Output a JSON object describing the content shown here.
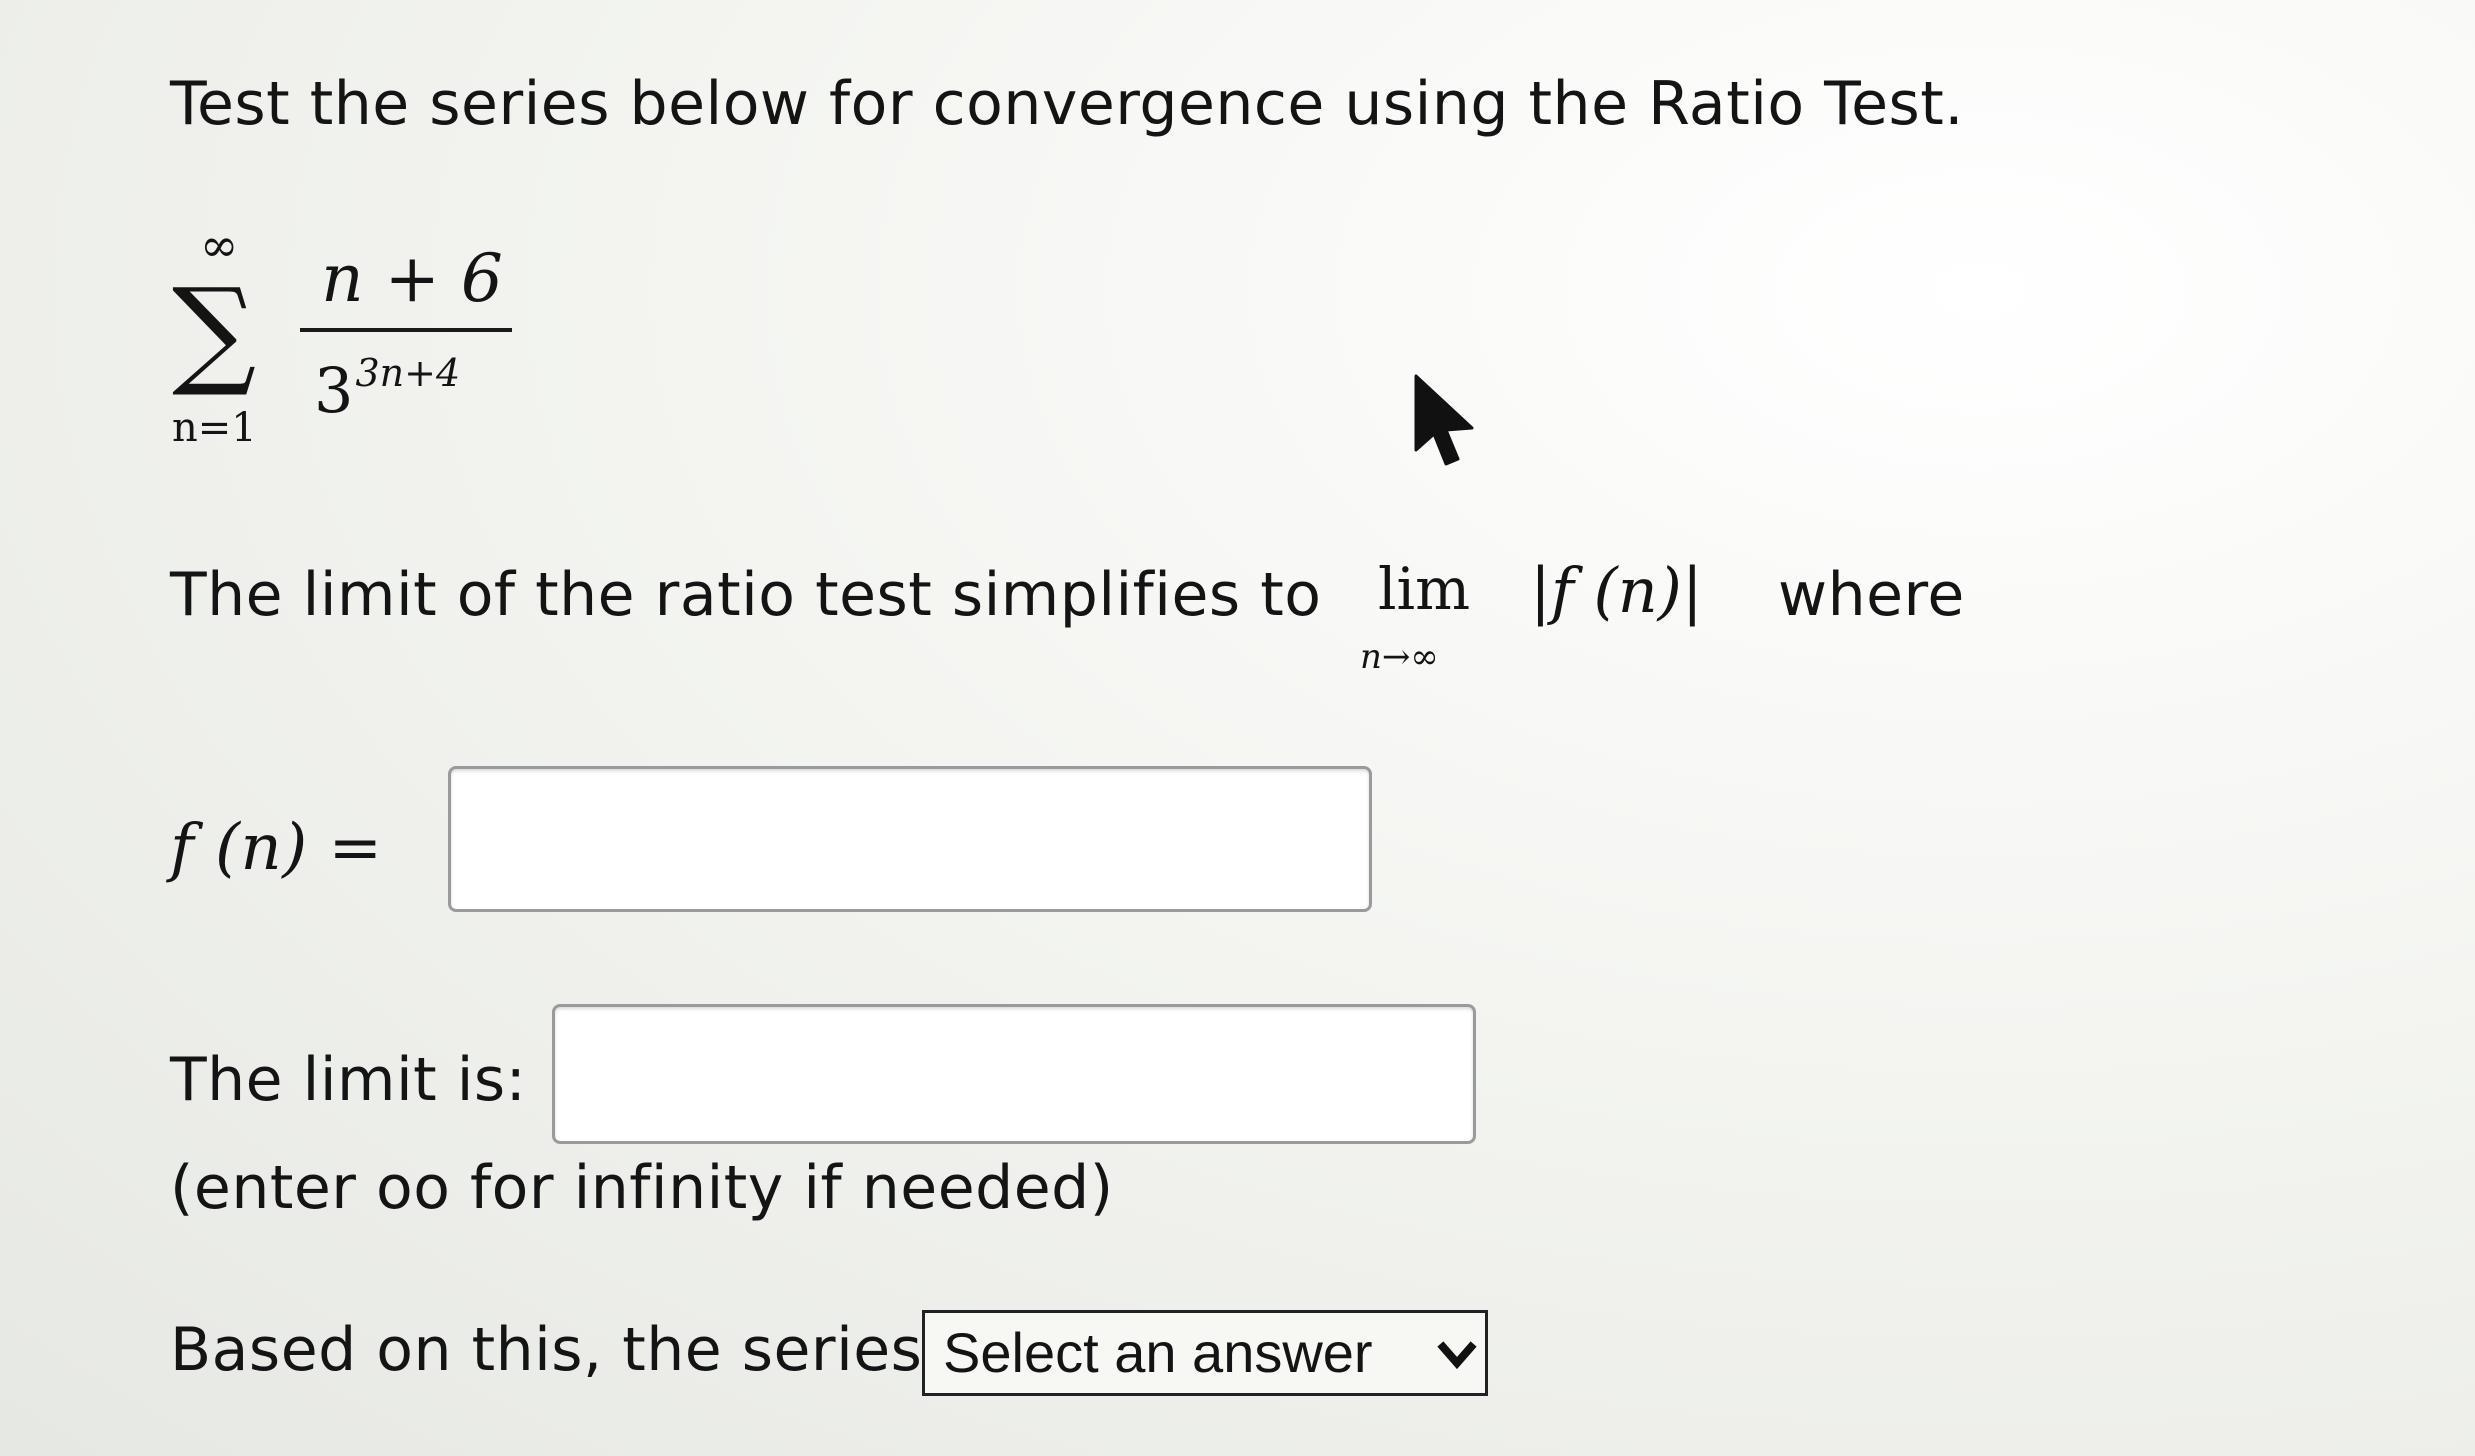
{
  "question": {
    "instruction": "Test the series below for convergence using the Ratio Test.",
    "series": {
      "sum_upper": "∞",
      "sum_lower": "n=1",
      "numerator": "n + 6",
      "denominator_base": "3",
      "denominator_exponent": "3n+4"
    },
    "limit_line": {
      "text": "The limit of the ratio test simplifies to",
      "lim_word": "lim",
      "lim_sub": "n→∞",
      "expression": "|f (n)|",
      "where": "where"
    },
    "fn_label": "f (n) =",
    "fn_input_value": "",
    "limit_label": "The limit is:",
    "limit_input_value": "",
    "limit_hint": "(enter oo for infinity if needed)",
    "conclusion_label": "Based on this, the series",
    "conclusion_select": {
      "selected": "Select an answer"
    }
  },
  "icons": {
    "cursor": "mouse-pointer-icon",
    "dropdown": "chevron-down-icon"
  }
}
